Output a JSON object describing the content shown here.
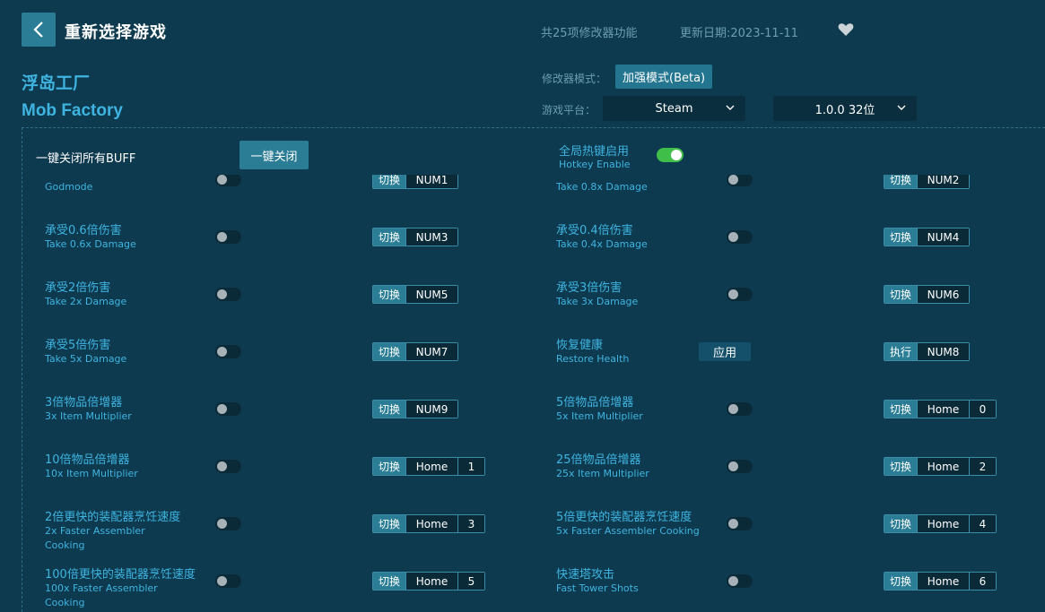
{
  "header": {
    "title": "重新选择游戏",
    "feature_count": "共25项修改器功能",
    "update_date": "更新日期:2023-11-11"
  },
  "game": {
    "name_cn": "浮岛工厂",
    "name_en": "Mob Factory"
  },
  "settings": {
    "mode_label": "修改器模式：",
    "mode_value": "加强模式(Beta)",
    "platform_label": "游戏平台：",
    "platform_value": "Steam",
    "version_value": "1.0.0 32位"
  },
  "panel": {
    "one_key_label": "一键关闭所有BUFF",
    "one_key_button": "一键关闭",
    "hotkey_cn": "全局热键启用",
    "hotkey_en": "Hotkey Enable",
    "hotkey_enabled": true
  },
  "options": [
    {
      "cn": "",
      "en": "Godmode",
      "control": "toggle",
      "action": "切换",
      "keys": [
        "NUM1"
      ]
    },
    {
      "cn": "",
      "en": "Take 0.8x Damage",
      "control": "toggle",
      "action": "切换",
      "keys": [
        "NUM2"
      ]
    },
    {
      "cn": "承受0.6倍伤害",
      "en": "Take 0.6x Damage",
      "control": "toggle",
      "action": "切换",
      "keys": [
        "NUM3"
      ]
    },
    {
      "cn": "承受0.4倍伤害",
      "en": "Take 0.4x Damage",
      "control": "toggle",
      "action": "切换",
      "keys": [
        "NUM4"
      ]
    },
    {
      "cn": "承受2倍伤害",
      "en": "Take 2x Damage",
      "control": "toggle",
      "action": "切换",
      "keys": [
        "NUM5"
      ]
    },
    {
      "cn": "承受3倍伤害",
      "en": "Take 3x Damage",
      "control": "toggle",
      "action": "切换",
      "keys": [
        "NUM6"
      ]
    },
    {
      "cn": "承受5倍伤害",
      "en": "Take 5x Damage",
      "control": "toggle",
      "action": "切换",
      "keys": [
        "NUM7"
      ]
    },
    {
      "cn": "恢复健康",
      "en": "Restore Health",
      "control": "apply",
      "apply_label": "应用",
      "action": "执行",
      "keys": [
        "NUM8"
      ]
    },
    {
      "cn": "3倍物品倍增器",
      "en": "3x Item Multiplier",
      "control": "toggle",
      "action": "切换",
      "keys": [
        "NUM9"
      ]
    },
    {
      "cn": "5倍物品倍增器",
      "en": "5x Item Multiplier",
      "control": "toggle",
      "action": "切换",
      "keys": [
        "Home",
        "0"
      ]
    },
    {
      "cn": "10倍物品倍增器",
      "en": "10x Item Multiplier",
      "control": "toggle",
      "action": "切换",
      "keys": [
        "Home",
        "1"
      ]
    },
    {
      "cn": "25倍物品倍增器",
      "en": "25x Item Multiplier",
      "control": "toggle",
      "action": "切换",
      "keys": [
        "Home",
        "2"
      ]
    },
    {
      "cn": "2倍更快的装配器烹饪速度",
      "en": "2x Faster Assembler Cooking",
      "control": "toggle",
      "action": "切换",
      "keys": [
        "Home",
        "3"
      ]
    },
    {
      "cn": "5倍更快的装配器烹饪速度",
      "en": "5x Faster Assembler Cooking",
      "control": "toggle",
      "action": "切换",
      "keys": [
        "Home",
        "4"
      ]
    },
    {
      "cn": "100倍更快的装配器烹饪速度",
      "en": "100x Faster Assembler Cooking",
      "control": "toggle",
      "action": "切换",
      "keys": [
        "Home",
        "5"
      ]
    },
    {
      "cn": "快速塔攻击",
      "en": "Fast Tower Shots",
      "control": "toggle",
      "action": "切换",
      "keys": [
        "Home",
        "6"
      ]
    }
  ]
}
